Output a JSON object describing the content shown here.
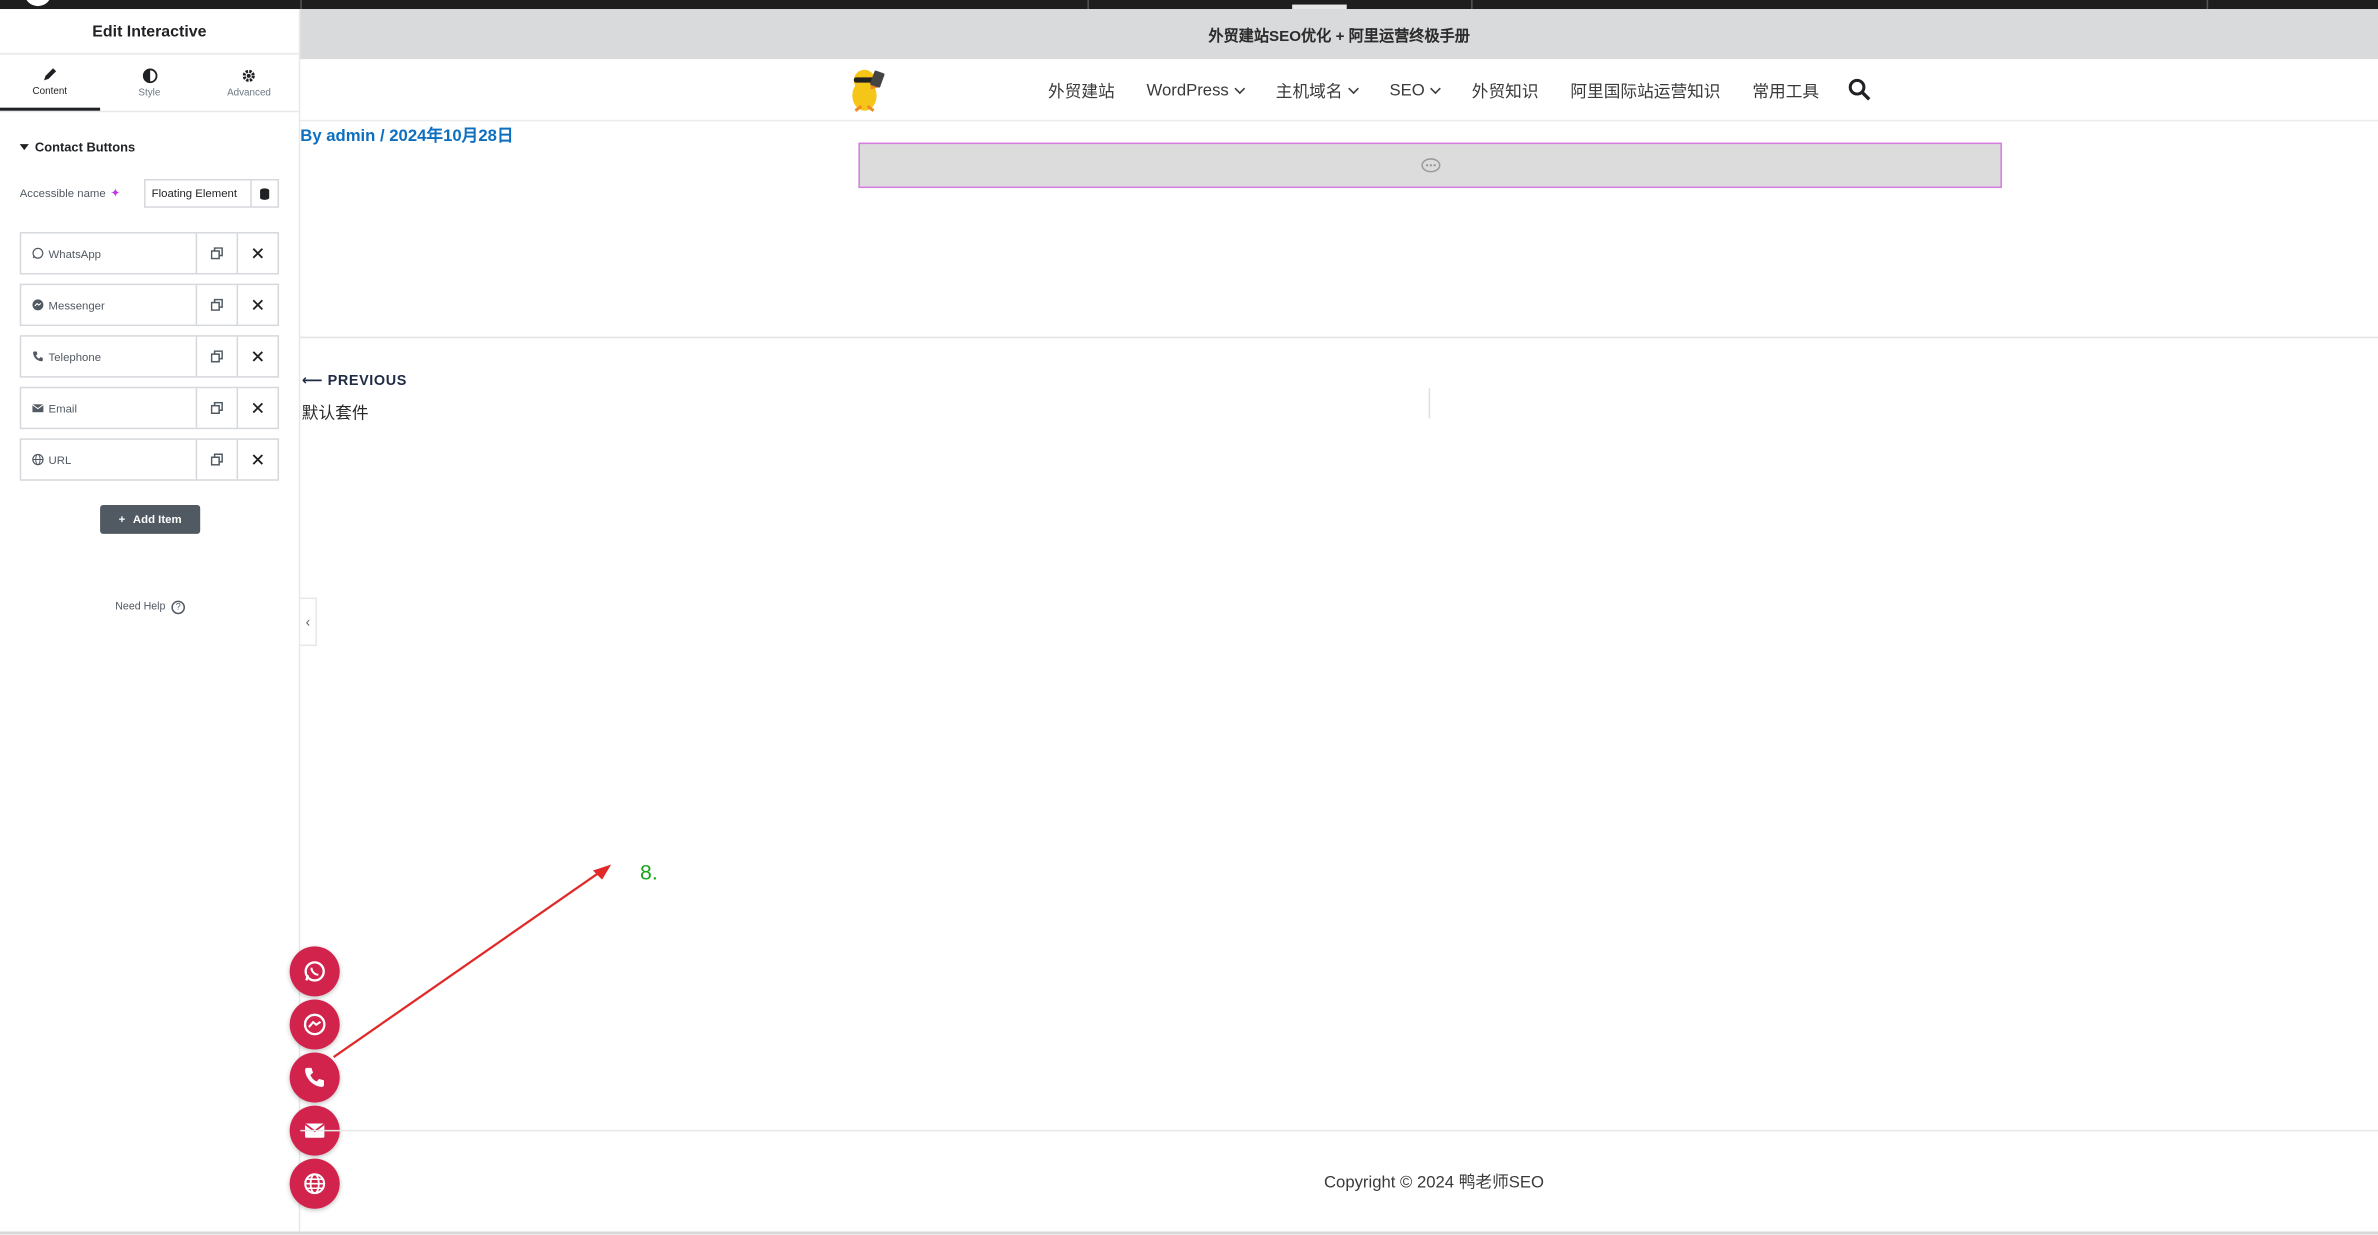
{
  "panel": {
    "title": "Edit Interactive",
    "tabs": [
      {
        "label": "Content",
        "icon": "pencil-icon"
      },
      {
        "label": "Style",
        "icon": "half-circle-icon"
      },
      {
        "label": "Advanced",
        "icon": "gear-icon"
      }
    ],
    "section_title": "Contact Buttons",
    "accessible_name_label": "Accessible name",
    "accessible_name_value": "Floating Element",
    "items": [
      {
        "label": "WhatsApp",
        "icon": "whatsapp-icon"
      },
      {
        "label": "Messenger",
        "icon": "messenger-icon"
      },
      {
        "label": "Telephone",
        "icon": "phone-icon"
      },
      {
        "label": "Email",
        "icon": "envelope-icon"
      },
      {
        "label": "URL",
        "icon": "globe-icon"
      }
    ],
    "add_item_label": "Add Item",
    "need_help_label": "Need Help"
  },
  "site": {
    "announcement": "外贸建站SEO优化 + 阿里运营终极手册",
    "nav": [
      {
        "label": "外贸建站",
        "has_dropdown": false
      },
      {
        "label": "WordPress",
        "has_dropdown": true
      },
      {
        "label": "主机域名",
        "has_dropdown": true
      },
      {
        "label": "SEO",
        "has_dropdown": true
      },
      {
        "label": "外贸知识",
        "has_dropdown": false
      },
      {
        "label": "阿里国际站运营知识",
        "has_dropdown": false
      },
      {
        "label": "常用工具",
        "has_dropdown": false
      }
    ],
    "byline": "By admin / 2024年10月28日",
    "previous_label": "PREVIOUS",
    "previous_title": "默认套件",
    "copyright": "Copyright © 2024 鸭老师SEO"
  },
  "annotation": {
    "number": "8.",
    "number_color": "#1aa31a",
    "arrow_color": "#e02a2a"
  },
  "floating_buttons": {
    "color": "#d2234c",
    "buttons": [
      "whatsapp-icon",
      "messenger-icon",
      "phone-icon",
      "envelope-icon",
      "globe-icon"
    ]
  }
}
